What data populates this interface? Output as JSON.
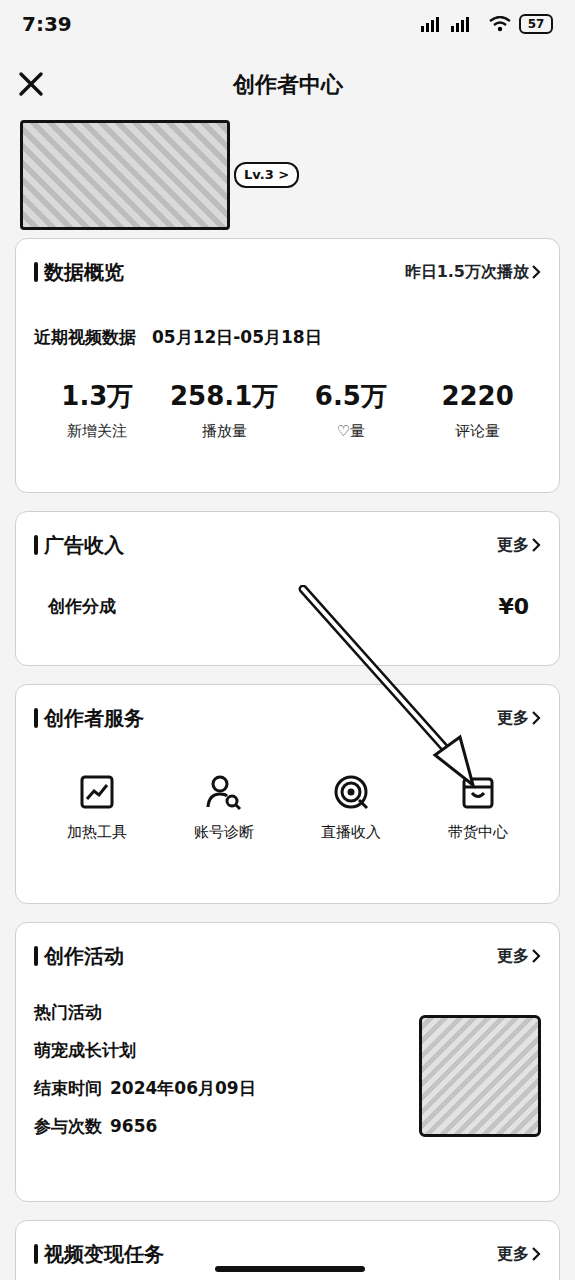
{
  "status_bar": {
    "time": "7:39",
    "battery": "57"
  },
  "header": {
    "title": "创作者中心"
  },
  "banner": {
    "badge": "Lv.3 >"
  },
  "overview": {
    "title": "数据概览",
    "link": "昨日1.5万次播放",
    "period_label": "近期视频数据",
    "period": "05月12日-05月18日",
    "stats": [
      {
        "value": "1.3万",
        "label": "新增关注"
      },
      {
        "value": "258.1万",
        "label": "播放量"
      },
      {
        "value": "6.5万",
        "label": "♡量"
      },
      {
        "value": "2220",
        "label": "评论量"
      }
    ]
  },
  "ad_income": {
    "title": "广告收入",
    "more": "更多",
    "rows": [
      {
        "label": "创作分成",
        "value": "¥0"
      }
    ]
  },
  "services": {
    "title": "创作者服务",
    "more": "更多",
    "items": [
      {
        "label": "加热工具",
        "kind": "chart"
      },
      {
        "label": "账号诊断",
        "kind": "diagnose"
      },
      {
        "label": "直播收入",
        "kind": "live"
      },
      {
        "label": "带货中心",
        "kind": "shop"
      }
    ]
  },
  "activities": {
    "title": "创作活动",
    "more": "更多",
    "section": "热门活动",
    "name": "萌宠成长计划",
    "fields": [
      {
        "label": "结束时间",
        "value": "2024年06月09日"
      },
      {
        "label": "参与次数",
        "value": "9656"
      }
    ]
  },
  "tasks": {
    "title": "视频变现任务",
    "more": "更多"
  }
}
